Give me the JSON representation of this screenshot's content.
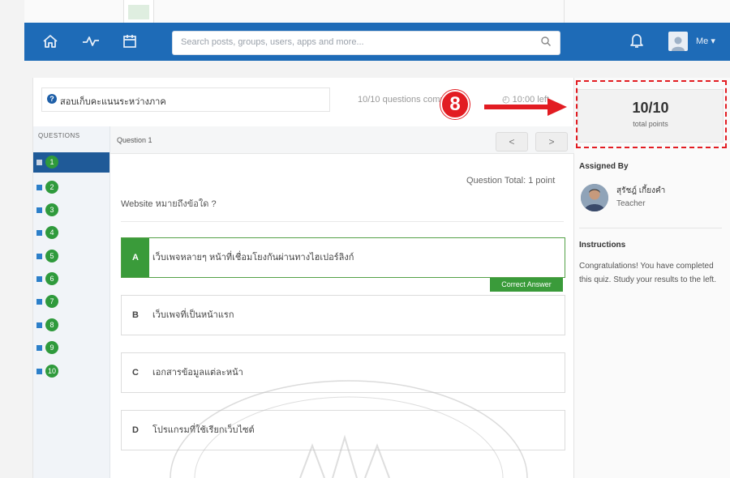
{
  "navbar": {
    "search_placeholder": "Search posts, groups, users, apps and more...",
    "user_label": "Me"
  },
  "quiz": {
    "title": "สอบเก็บคะแนนระหว่างภาค",
    "status": "10/10 questions completed",
    "timer": "10:00 left"
  },
  "sidebar": {
    "header": "QUESTIONS",
    "numbers": [
      "1",
      "2",
      "3",
      "4",
      "5",
      "6",
      "7",
      "8",
      "9",
      "10"
    ]
  },
  "question": {
    "label": "Question 1",
    "prev": "<",
    "next": ">",
    "total": "Question Total: 1 point",
    "text": "Website หมายถึงข้อใด ?",
    "options": [
      {
        "letter": "A",
        "text": "เว็บเพจหลายๆ หน้าที่เชื่อมโยงกันผ่านทางไฮเปอร์ลิงก์"
      },
      {
        "letter": "B",
        "text": "เว็บเพจที่เป็นหน้าแรก"
      },
      {
        "letter": "C",
        "text": "เอกสารข้อมูลแต่ละหน้า"
      },
      {
        "letter": "D",
        "text": "โปรแกรมที่ใช้เรียกเว็บไซต์"
      }
    ],
    "correct_label": "Correct Answer"
  },
  "right_panel": {
    "points_value": "10/10",
    "points_label": "total points",
    "assigned_by_heading": "Assigned By",
    "teacher_name": "สุรัชฎ์ เกี้ยงคำ",
    "teacher_role": "Teacher",
    "instructions_heading": "Instructions",
    "instructions_text": "Congratulations! You have completed this quiz. Study your results to the left."
  },
  "annotation": {
    "number": "8",
    "color": "#e21c22"
  },
  "colors": {
    "navbar": "#1e6bb7",
    "correct_green": "#3a9b3a",
    "accent_red": "#e21c22"
  }
}
